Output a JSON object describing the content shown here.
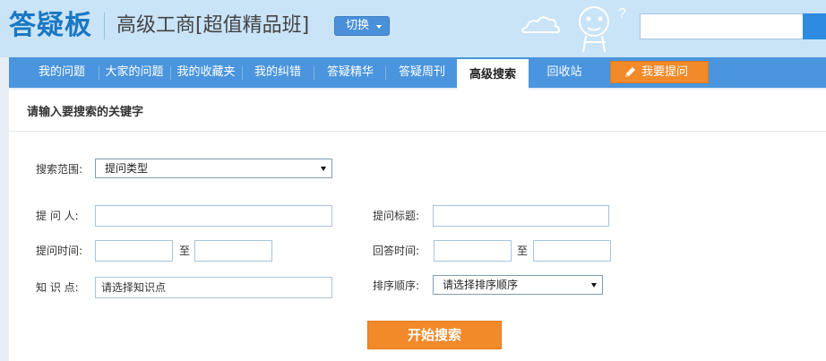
{
  "header": {
    "logo": "答疑板",
    "course_title": "高级工商[超值精品班]",
    "switch_label": "切换",
    "search": {
      "value": "",
      "placeholder": ""
    }
  },
  "nav": {
    "items": [
      {
        "label": "我的问题"
      },
      {
        "label": "大家的问题"
      },
      {
        "label": "我的收藏夹"
      },
      {
        "label": "我的纠错"
      },
      {
        "label": "答疑精华"
      },
      {
        "label": "答疑周刊"
      },
      {
        "label": "高级搜索",
        "active": true
      },
      {
        "label": "回收站"
      }
    ],
    "ask_label": "我要提问"
  },
  "panel": {
    "title": "请输入要搜索的关键字"
  },
  "form": {
    "scope_label": "搜索范围:",
    "scope_value": "提问类型",
    "asker_label": "提 问 人:",
    "asker_value": "",
    "title_label": "提问标题:",
    "title_value": "",
    "ask_time_label": "提问时间:",
    "ask_time_from": "",
    "ask_time_to": "",
    "answer_time_label": "回答时间:",
    "answer_time_from": "",
    "answer_time_to": "",
    "to_label": "至",
    "knowledge_label": "知 识 点:",
    "knowledge_value": "请选择知识点",
    "sort_label": "排序顺序:",
    "sort_value": "请选择排序顺序",
    "submit_label": "开始搜索"
  },
  "colors": {
    "header_bg": "#c9e3f7",
    "nav_bg": "#4a95dd",
    "accent_orange": "#f28a2a",
    "logo_blue": "#1a78c2"
  }
}
